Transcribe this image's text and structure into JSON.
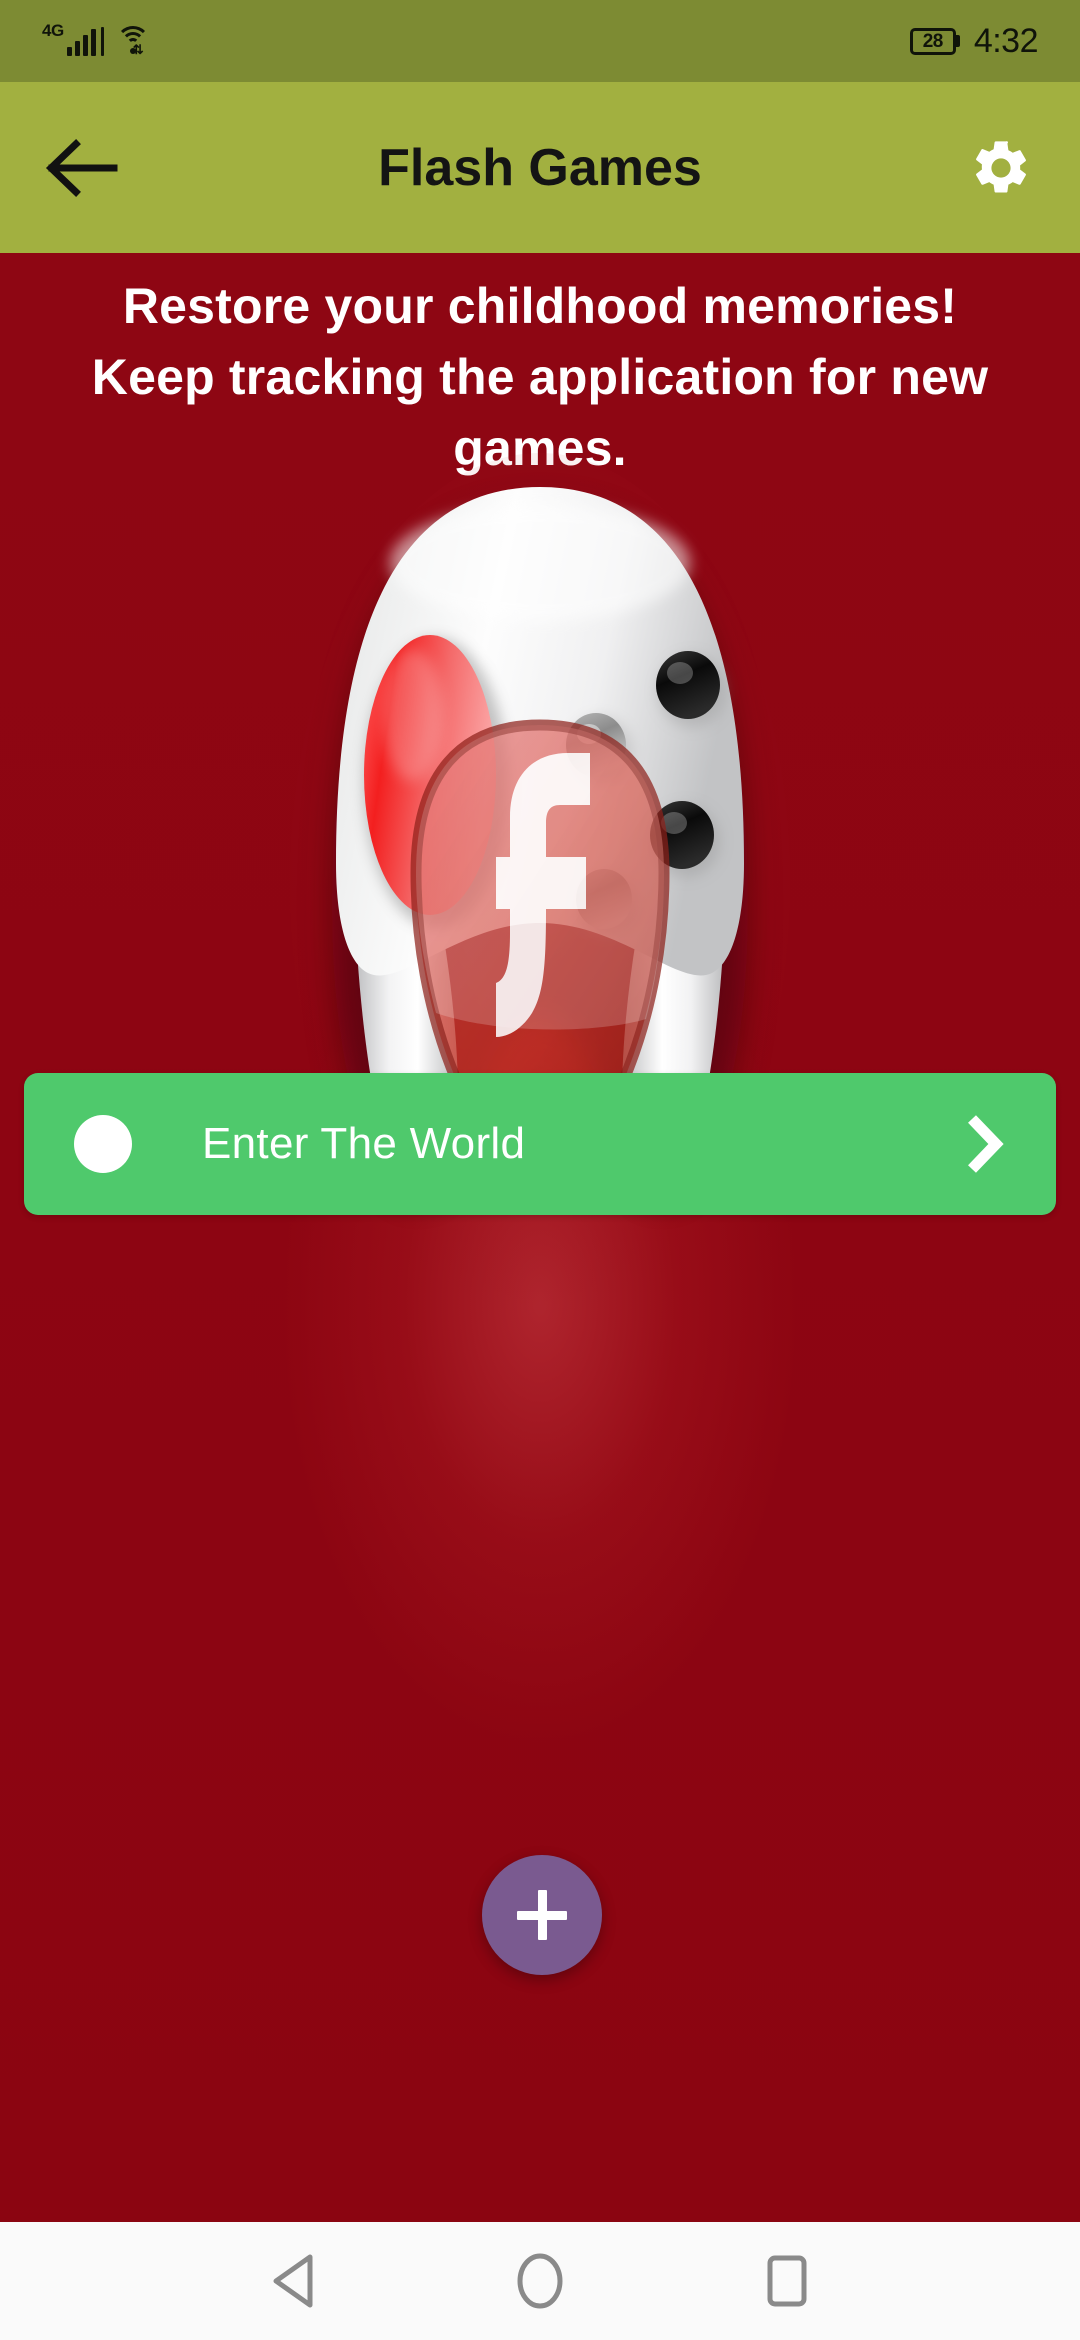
{
  "status_bar": {
    "network_type": "4G",
    "signal_icon": "signal-bars-icon",
    "wifi_icon": "wifi-icon",
    "battery_level": "28",
    "battery_icon": "battery-icon",
    "time": "4:32",
    "background_color": "#7d8b33",
    "foreground_color": "#10140a"
  },
  "app_bar": {
    "back_icon": "arrow-left-icon",
    "title": "Flash Games",
    "settings_icon": "gear-icon",
    "background_color": "#a2b040",
    "title_color": "#141414",
    "settings_icon_color": "#ffffff"
  },
  "content": {
    "background_color": "#8e0613",
    "tagline": "Restore your childhood memories! Keep tracking the application for new games.",
    "tagline_color": "#ffffff",
    "illustration": {
      "name": "flash-gamepad-illustration",
      "description": "White game controller with red d-pad and dark action buttons, overlaid with a translucent red Adobe Flash f logo"
    }
  },
  "cta_button": {
    "label": "Enter The World",
    "leading_icon": "circle-icon",
    "trailing_icon": "chevron-right-icon",
    "background_color": "#4fc96c",
    "label_color": "#ffffff"
  },
  "fab": {
    "icon": "plus-icon",
    "background_color": "#7a5a90",
    "icon_color": "#ffffff"
  },
  "nav_bar": {
    "background_color": "#fafafa",
    "icon_color": "#8a8a8a",
    "buttons": [
      {
        "name": "back",
        "icon": "triangle-left-icon"
      },
      {
        "name": "home",
        "icon": "circle-outline-icon"
      },
      {
        "name": "recents",
        "icon": "square-outline-icon"
      }
    ]
  }
}
